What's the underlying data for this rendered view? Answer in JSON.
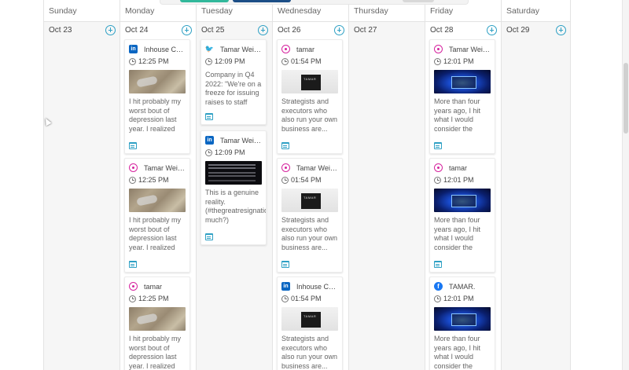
{
  "calendar": {
    "days": [
      {
        "weekday": "Sunday",
        "date": "Oct 23",
        "posts": []
      },
      {
        "weekday": "Monday",
        "date": "Oct 24",
        "posts": [
          {
            "network": "linkedin",
            "network_icon": "linkedin-icon",
            "author": "Inhouse Co...",
            "time": "12:25 PM",
            "image": "shoes-photo",
            "text": "I hit probably my worst bout of depression last year. I realized the..."
          },
          {
            "network": "instagram",
            "network_icon": "instagram-icon",
            "author": "Tamar Wein...",
            "time": "12:25 PM",
            "image": "shoes-photo",
            "text": "I hit probably my worst bout of depression last year. I realized the..."
          },
          {
            "network": "instagram",
            "network_icon": "instagram-icon",
            "author": "tamar",
            "time": "12:25 PM",
            "image": "shoes-photo",
            "text": "I hit probably my worst bout of depression last year. I realized the..."
          }
        ]
      },
      {
        "weekday": "Tuesday",
        "date": "Oct 25",
        "posts": [
          {
            "network": "twitter",
            "network_icon": "twitter-icon",
            "author": "Tamar Wein...",
            "time": "12:09 PM",
            "image": "",
            "text": "Company in Q4 2022: \"We're on a freeze for issuing raises to staff sinc..."
          },
          {
            "network": "linkedin",
            "network_icon": "linkedin-icon",
            "author": "Tamar Wein...",
            "time": "12:09 PM",
            "image": "tweet-screenshot",
            "text": "This is a genuine reality. (#thegreatresignation much?)"
          }
        ]
      },
      {
        "weekday": "Wednesday",
        "date": "Oct 26",
        "posts": [
          {
            "network": "instagram",
            "network_icon": "instagram-icon",
            "author": "tamar",
            "time": "01:54 PM",
            "image": "box-photo",
            "text": "Strategists and executors who also run your own business are..."
          },
          {
            "network": "instagram",
            "network_icon": "instagram-icon",
            "author": "Tamar Wein...",
            "time": "01:54 PM",
            "image": "box-photo",
            "text": "Strategists and executors who also run your own business are..."
          },
          {
            "network": "linkedin",
            "network_icon": "linkedin-icon",
            "author": "Inhouse Co...",
            "time": "01:54 PM",
            "image": "box-photo",
            "text": "Strategists and executors who also run your own business are..."
          }
        ]
      },
      {
        "weekday": "Thursday",
        "date": "Oct 27",
        "posts": []
      },
      {
        "weekday": "Friday",
        "date": "Oct 28",
        "posts": [
          {
            "network": "instagram",
            "network_icon": "instagram-icon",
            "author": "Tamar Wein...",
            "time": "12:01 PM",
            "image": "blue-light-photo",
            "text": "More than four years ago, I hit what I would consider the worst mental..."
          },
          {
            "network": "instagram",
            "network_icon": "instagram-icon",
            "author": "tamar",
            "time": "12:01 PM",
            "image": "blue-light-photo",
            "text": "More than four years ago, I hit what I would consider the worst mental..."
          },
          {
            "network": "facebook",
            "network_icon": "facebook-icon",
            "author": "TAMAR.",
            "time": "12:01 PM",
            "image": "blue-light-photo",
            "text": "More than four years ago, I hit what I would consider the worst mental..."
          }
        ]
      },
      {
        "weekday": "Saturday",
        "date": "Oct 29",
        "posts": []
      }
    ]
  },
  "colors": {
    "accent": "#2ea0c4",
    "linkedin": "#0a66c2",
    "instagram": "#d6249f",
    "twitter": "#1da1f2",
    "facebook": "#1877f2"
  }
}
